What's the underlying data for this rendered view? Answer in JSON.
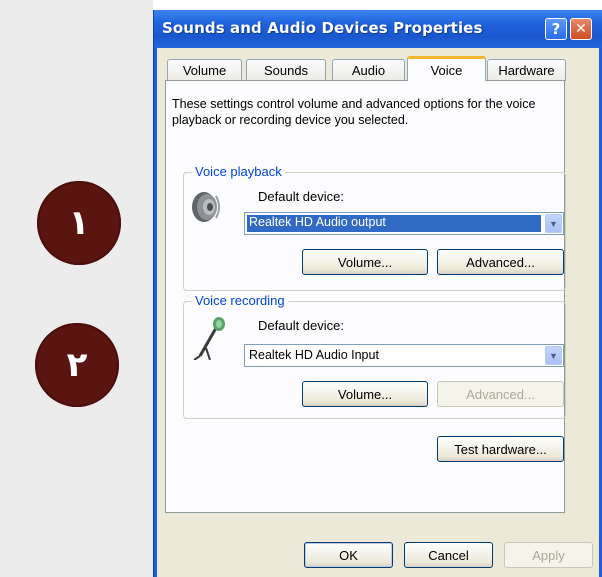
{
  "annotations": {
    "badge_1": "١",
    "badge_2": "٢"
  },
  "window": {
    "title": "Sounds and Audio Devices Properties",
    "help_label": "?",
    "close_label": "✕"
  },
  "tabs": [
    {
      "label": "Volume",
      "active": false
    },
    {
      "label": "Sounds",
      "active": false
    },
    {
      "label": "Audio",
      "active": false
    },
    {
      "label": "Voice",
      "active": true
    },
    {
      "label": "Hardware",
      "active": false
    }
  ],
  "voice_tab": {
    "description": "These settings control volume and advanced options for the voice playback or recording device you selected.",
    "playback": {
      "group_label": "Voice playback",
      "icon": "speaker-icon",
      "default_device_label": "Default device:",
      "device_value": "Realtek HD Audio output",
      "volume_button": "Volume...",
      "advanced_button": "Advanced..."
    },
    "recording": {
      "group_label": "Voice recording",
      "icon": "microphone-icon",
      "default_device_label": "Default device:",
      "device_value": "Realtek HD Audio Input",
      "volume_button": "Volume...",
      "advanced_button": "Advanced...",
      "advanced_disabled": true
    },
    "test_hardware_button": "Test hardware..."
  },
  "footer": {
    "ok_button": "OK",
    "cancel_button": "Cancel",
    "apply_button": "Apply",
    "apply_disabled": true
  },
  "colors": {
    "title_bar": "#1f62dc",
    "dialog_bg": "#ece9d8",
    "group_label": "#0046d5",
    "badge": "#5b1510",
    "selection": "#316ac5"
  }
}
